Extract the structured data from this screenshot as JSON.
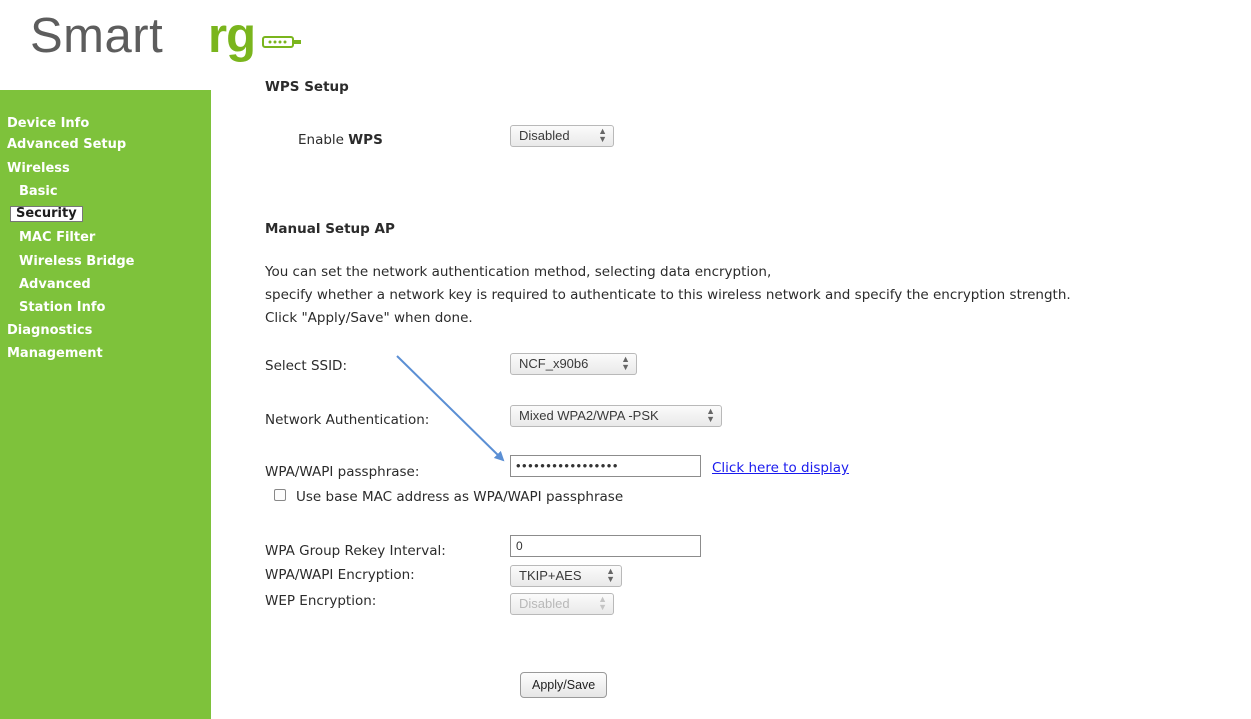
{
  "logo": {
    "smart": "Smart",
    "rg": "rg",
    "plug_icon": "router-plug-icon"
  },
  "sidebar": {
    "items": [
      {
        "label": "Device Info"
      },
      {
        "label": "Advanced Setup"
      },
      {
        "label": "Wireless"
      },
      {
        "label": "Basic"
      },
      {
        "label": "Security",
        "active": true
      },
      {
        "label": "MAC Filter"
      },
      {
        "label": "Wireless Bridge"
      },
      {
        "label": "Advanced"
      },
      {
        "label": "Station Info"
      },
      {
        "label": "Diagnostics"
      },
      {
        "label": "Management"
      }
    ]
  },
  "wps": {
    "title": "WPS Setup",
    "enable_prefix": "Enable ",
    "enable_bold": "WPS",
    "value": "Disabled"
  },
  "manual": {
    "title": "Manual Setup AP",
    "desc": [
      "You can set the network authentication method, selecting data encryption,",
      "specify whether a network key is required to authenticate to this wireless network and specify the encryption strength.",
      "Click \"Apply/Save\" when done."
    ],
    "ssid_label": "Select SSID:",
    "ssid_value": "NCF_x90b6",
    "auth_label": "Network Authentication:",
    "auth_value": "Mixed WPA2/WPA -PSK",
    "pass_label": "WPA/WAPI passphrase:",
    "pass_value": "•••••••••••••••••",
    "pass_link": "Click here to display",
    "mac_checkbox_label": "Use base MAC address as WPA/WAPI passphrase",
    "mac_checkbox_checked": false,
    "rekey_label": "WPA Group Rekey Interval:",
    "rekey_value": "0",
    "enc_label": "WPA/WAPI Encryption:",
    "enc_value": "TKIP+AES",
    "wep_label": "WEP Encryption:",
    "wep_value": "Disabled",
    "apply_button": "Apply/Save"
  },
  "colors": {
    "sidebar": "#7ec23b",
    "brand_green": "#7ab51d",
    "link": "#1a1aee",
    "annotation_arrow": "#5b8fd4"
  }
}
